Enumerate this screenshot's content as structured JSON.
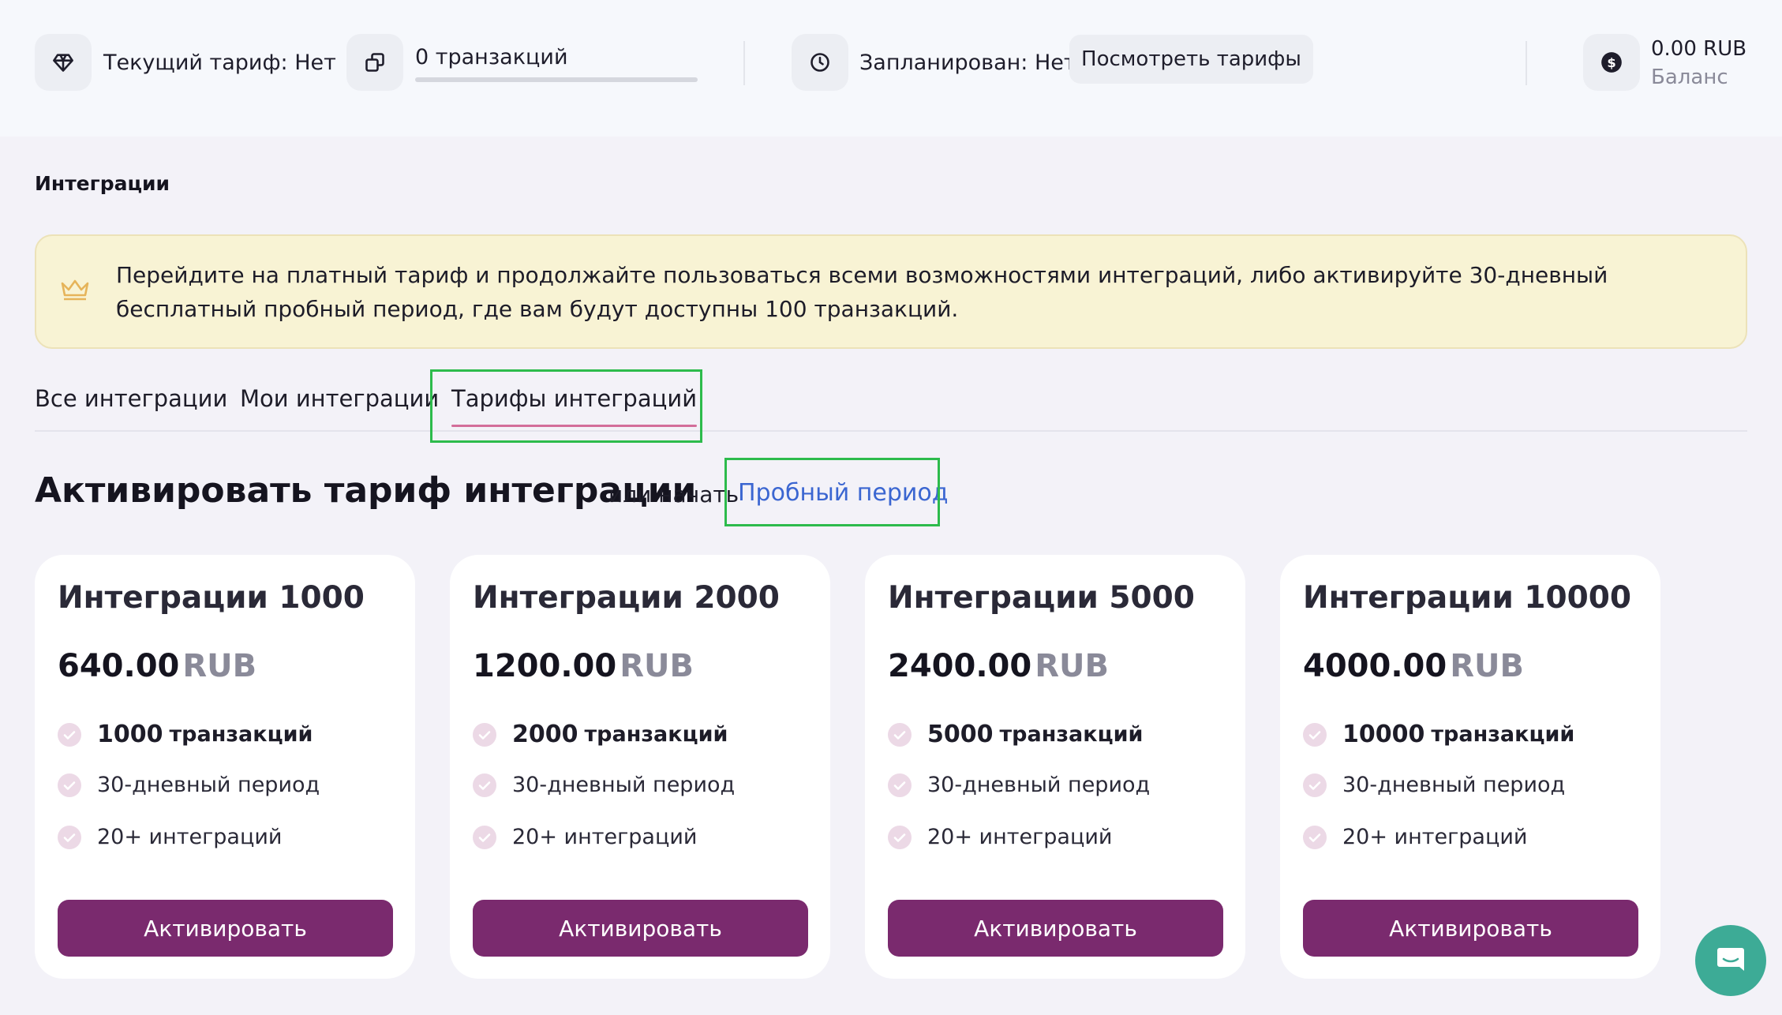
{
  "header": {
    "current_tariff": "Текущий тариф: Нет",
    "transactions": "0 транзакций",
    "transactions_progress": 0,
    "scheduled": "Запланирован: Нет",
    "view_tariffs_button": "Посмотреть тарифы",
    "balance_amount": "0.00 RUB",
    "balance_label": "Баланс",
    "icons": [
      "diamond-icon",
      "copy-icon",
      "clock-icon",
      "dollar-coin-icon"
    ]
  },
  "page": {
    "title": "Интеграции"
  },
  "banner": {
    "text": "Перейдите на платный тариф и продолжайте пользоваться всеми возможностями интеграций, либо активируйте 30-дневный бесплатный пробный период, где вам будут доступны 100 транзакций.",
    "icon": "crown-icon",
    "accent_color": "#e6b45a"
  },
  "tabs": {
    "items": [
      {
        "label": "Все интеграции"
      },
      {
        "label": "Мои интеграции"
      },
      {
        "label": "Тарифы интеграций"
      }
    ],
    "active_index": 2
  },
  "section": {
    "heading": "Активировать тариф интеграции",
    "or_start": "или начать",
    "trial_link": "Пробный период"
  },
  "plans": [
    {
      "name": "Интеграции 1000",
      "price": "640.00",
      "currency": "RUB",
      "transactions_count": "1000",
      "transactions_unit": "транзакций",
      "period": "30-дневный период",
      "integrations": "20+ интеграций",
      "button": "Активировать"
    },
    {
      "name": "Интеграции 2000",
      "price": "1200.00",
      "currency": "RUB",
      "transactions_count": "2000",
      "transactions_unit": "транзакций",
      "period": "30-дневный период",
      "integrations": "20+ интеграций",
      "button": "Активировать"
    },
    {
      "name": "Интеграции 5000",
      "price": "2400.00",
      "currency": "RUB",
      "transactions_count": "5000",
      "transactions_unit": "транзакций",
      "period": "30-дневный период",
      "integrations": "20+ интеграций",
      "button": "Активировать"
    },
    {
      "name": "Интеграции 10000",
      "price": "4000.00",
      "currency": "RUB",
      "transactions_count": "10000",
      "transactions_unit": "транзакций",
      "period": "30-дневный период",
      "integrations": "20+ интеграций",
      "button": "Активировать"
    }
  ],
  "colors": {
    "brand_primary": "#7a2a6e",
    "link": "#3b66d1",
    "banner_bg": "#f8f3d4",
    "check_bg": "#ecd9e6",
    "tab_underline": "#d36e9a",
    "highlight": "#2dbb4c",
    "chat_launcher": "#3dab96"
  }
}
